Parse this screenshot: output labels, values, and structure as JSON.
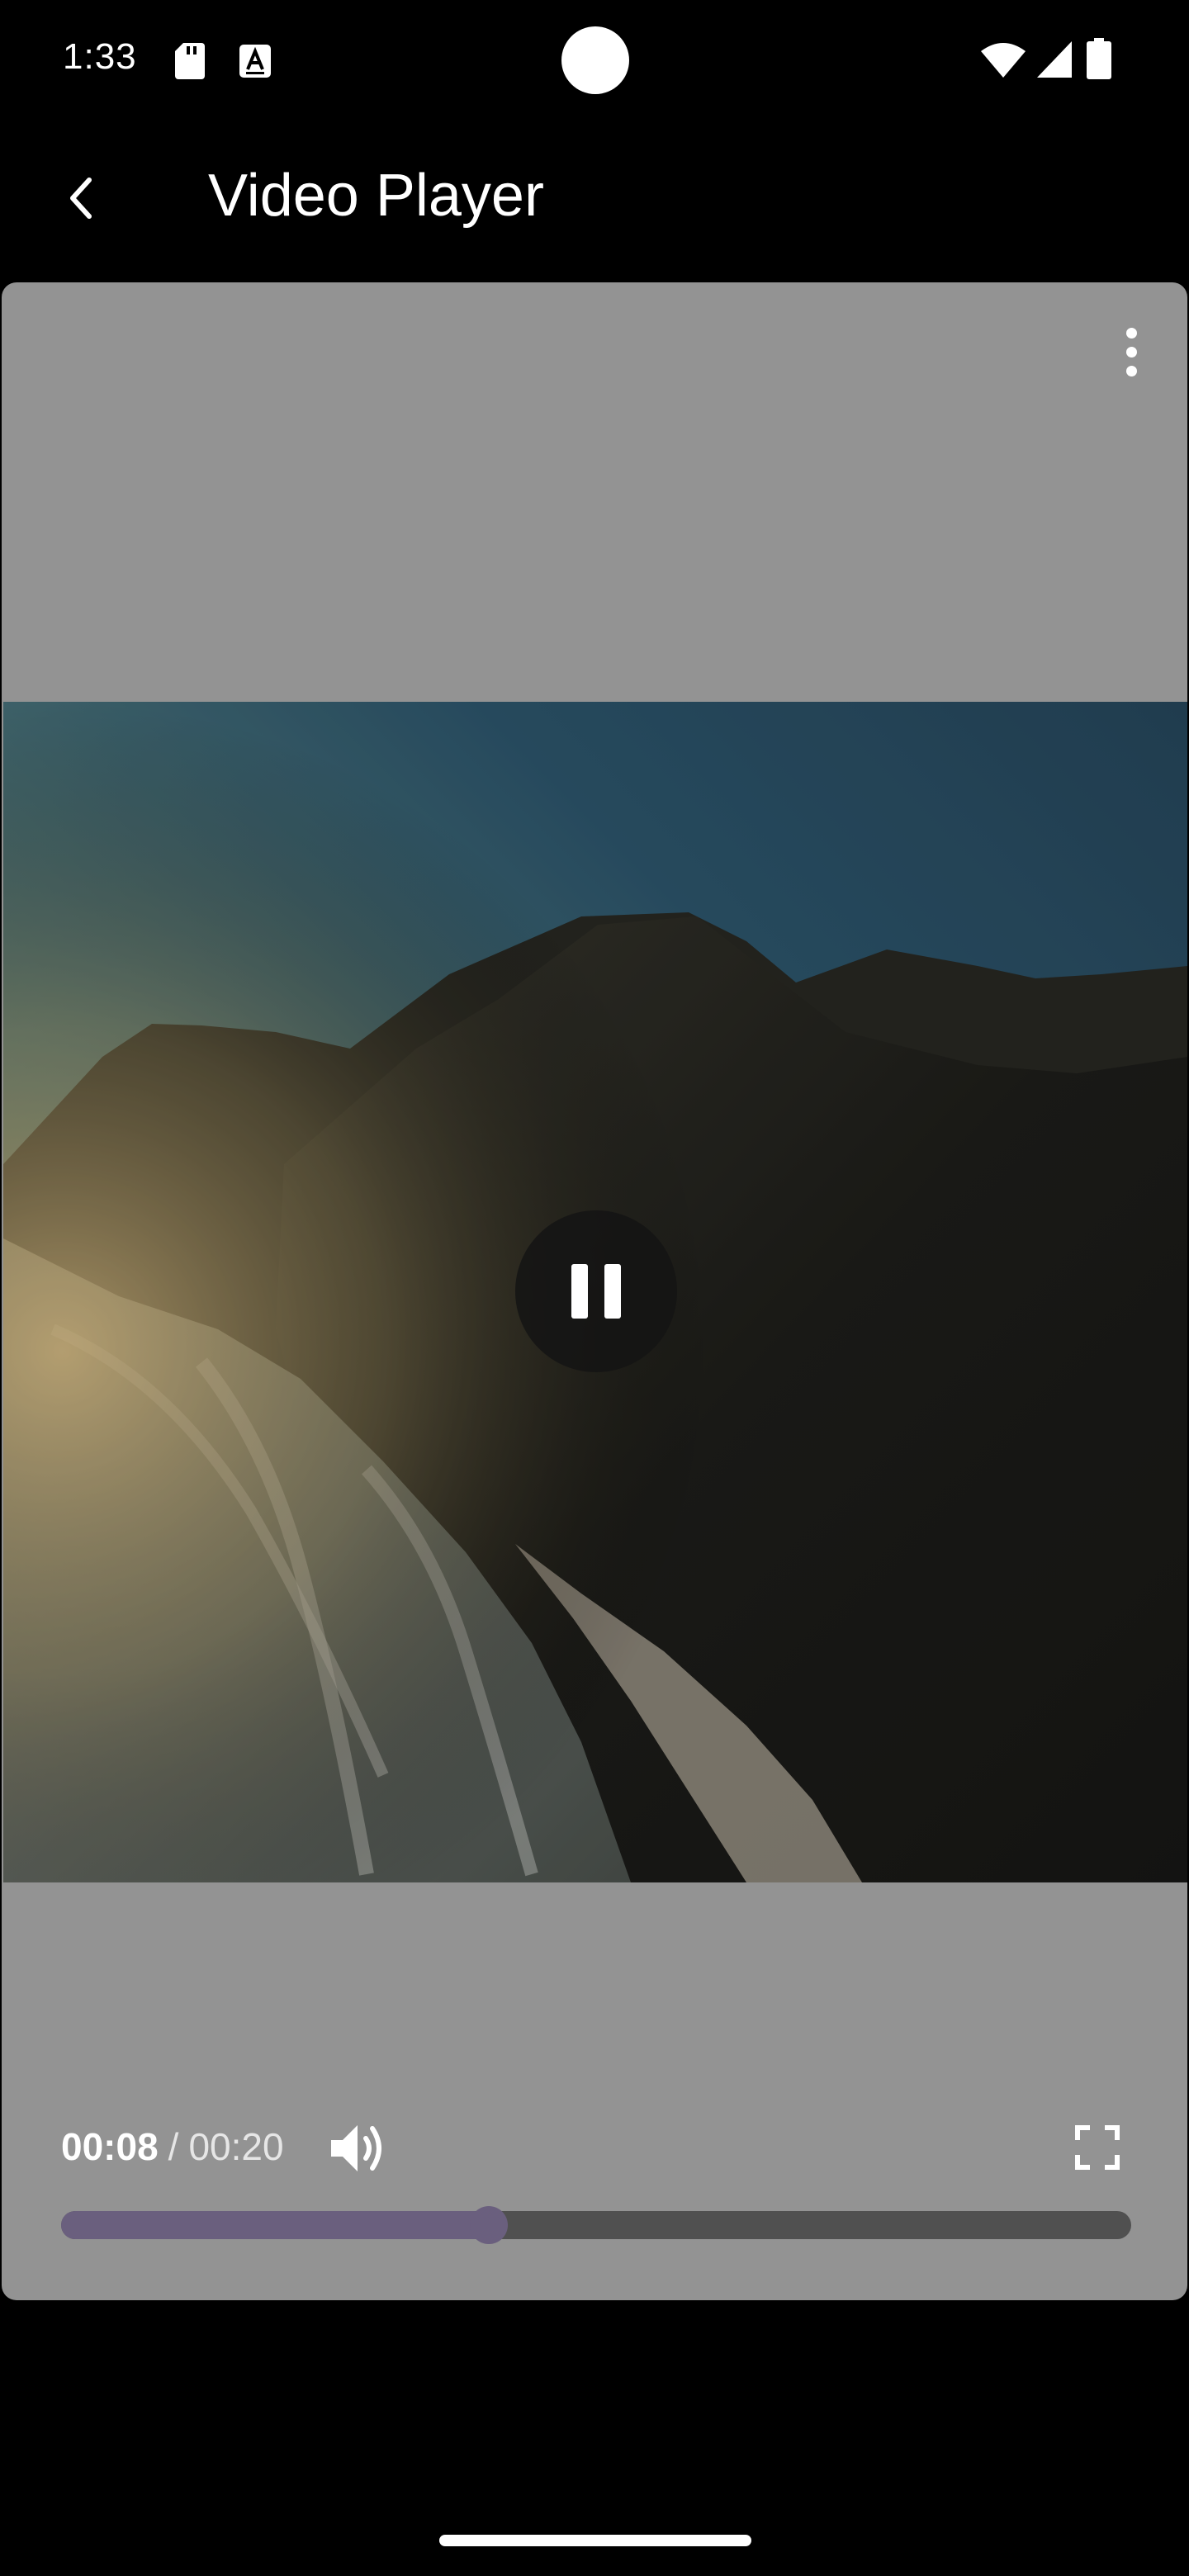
{
  "status_bar": {
    "time": "1:33",
    "icons": [
      "sd-card-icon",
      "a-keyboard-icon",
      "wifi-icon",
      "signal-icon",
      "battery-icon"
    ]
  },
  "app_bar": {
    "back_icon": "chevron-left-icon",
    "title": "Video Player"
  },
  "player": {
    "more_icon": "more-vertical-icon",
    "play_state_icon": "pause-icon",
    "time_current": "00:08",
    "time_separator": "/",
    "time_total": "00:20",
    "volume_icon": "volume-icon",
    "fullscreen_icon": "fullscreen-icon",
    "progress_fraction": 0.4,
    "colors": {
      "player_background": "#939393",
      "progress_fill": "#6a5f7e",
      "progress_track": "#505050"
    }
  }
}
